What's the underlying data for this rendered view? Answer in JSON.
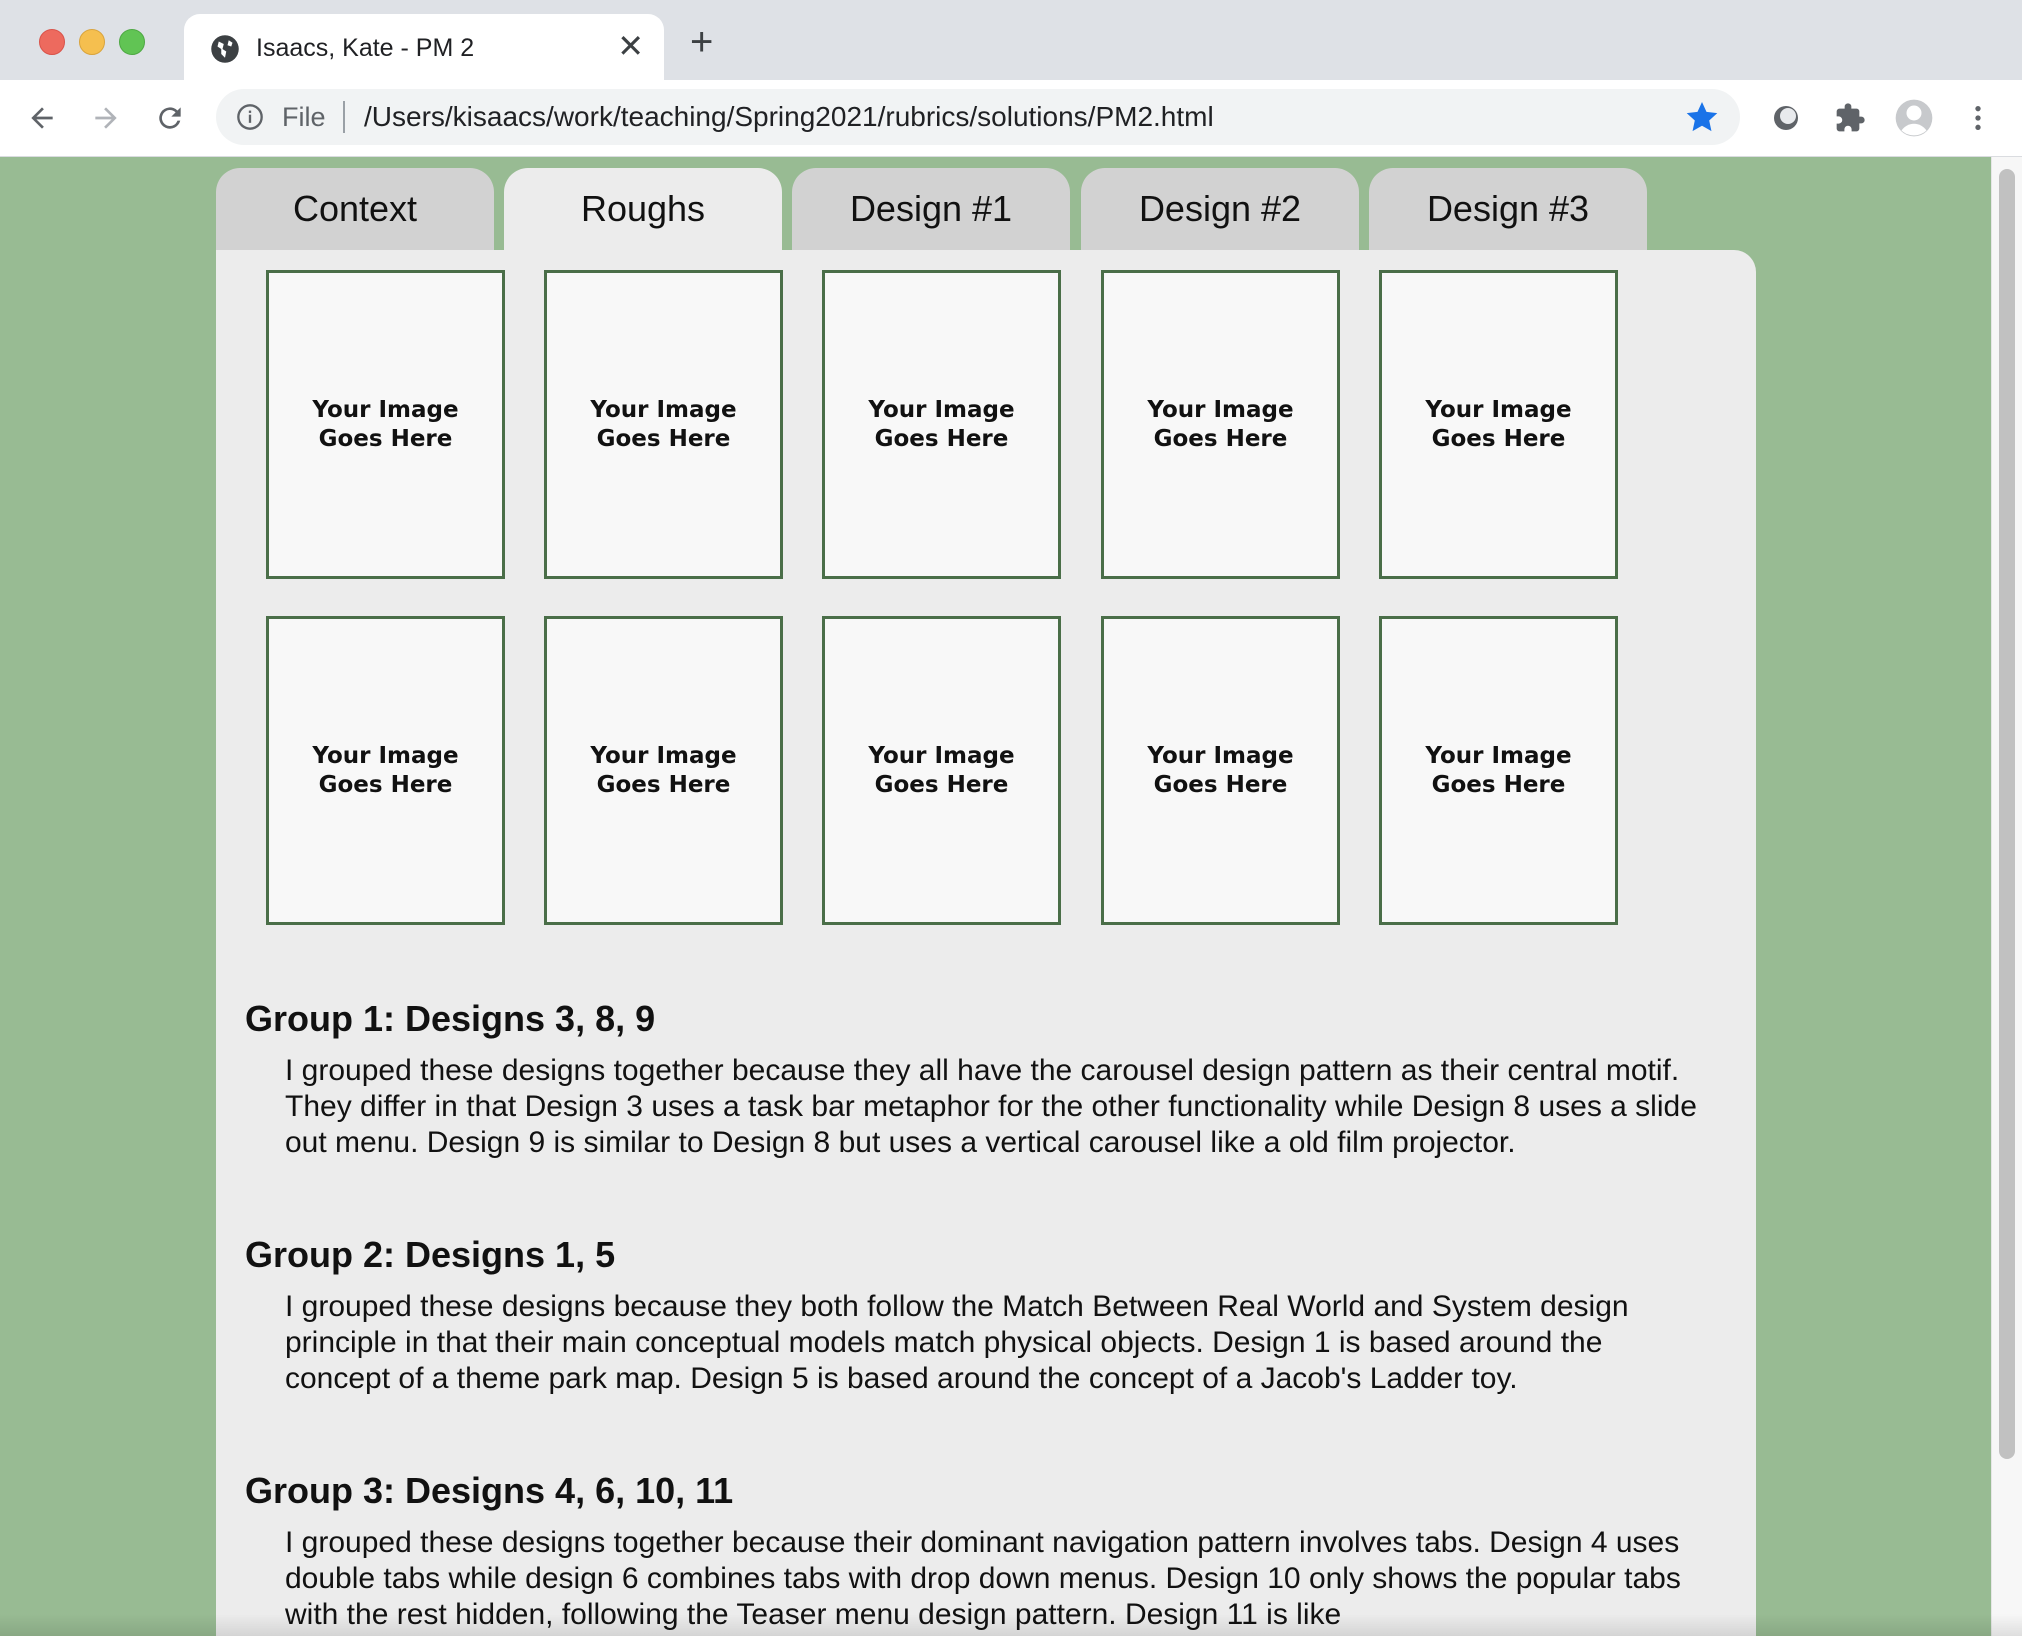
{
  "browser": {
    "tab_title": "Isaacs, Kate - PM 2",
    "new_tab_symbol": "+",
    "close_symbol": "✕",
    "scheme_label": "File",
    "url": "/Users/kisaacs/work/teaching/Spring2021/rubrics/solutions/PM2.html",
    "bookmark_star_color": "#1a73e8"
  },
  "page": {
    "tabs": [
      {
        "label": "Context",
        "active": false
      },
      {
        "label": "Roughs",
        "active": true
      },
      {
        "label": "Design #1",
        "active": false
      },
      {
        "label": "Design #2",
        "active": false
      },
      {
        "label": "Design #3",
        "active": false
      }
    ],
    "image_placeholder": {
      "line1": "Your Image",
      "line2": "Goes Here",
      "count": 10
    },
    "groups": [
      {
        "heading": "Group 1: Designs 3, 8, 9",
        "text": "I grouped these designs together because they all have the carousel design pattern as their central motif. They differ in that Design 3 uses a task bar metaphor for the other functionality while Design 8 uses a slide out menu. Design 9 is similar to Design 8 but uses a vertical carousel like a old film projector."
      },
      {
        "heading": "Group 2: Designs 1, 5",
        "text": "I grouped these designs because they both follow the Match Between Real World and System design principle in that their main conceptual models match physical objects. Design 1 is based around the concept of a theme park map. Design 5 is based around the concept of a Jacob's Ladder toy."
      },
      {
        "heading": "Group 3: Designs 4, 6, 10, 11",
        "text": "I grouped these designs together because their dominant navigation pattern involves tabs. Design 4 uses double tabs while design 6 combines tabs with drop down menus. Design 10 only shows the popular tabs with the rest hidden, following the Teaser menu design pattern. Design 11 is like"
      }
    ]
  },
  "colors": {
    "page_background": "#98bb93",
    "panel_background": "#ececec",
    "inactive_tab": "#d2d2d2",
    "placeholder_border": "#4a6e48"
  }
}
